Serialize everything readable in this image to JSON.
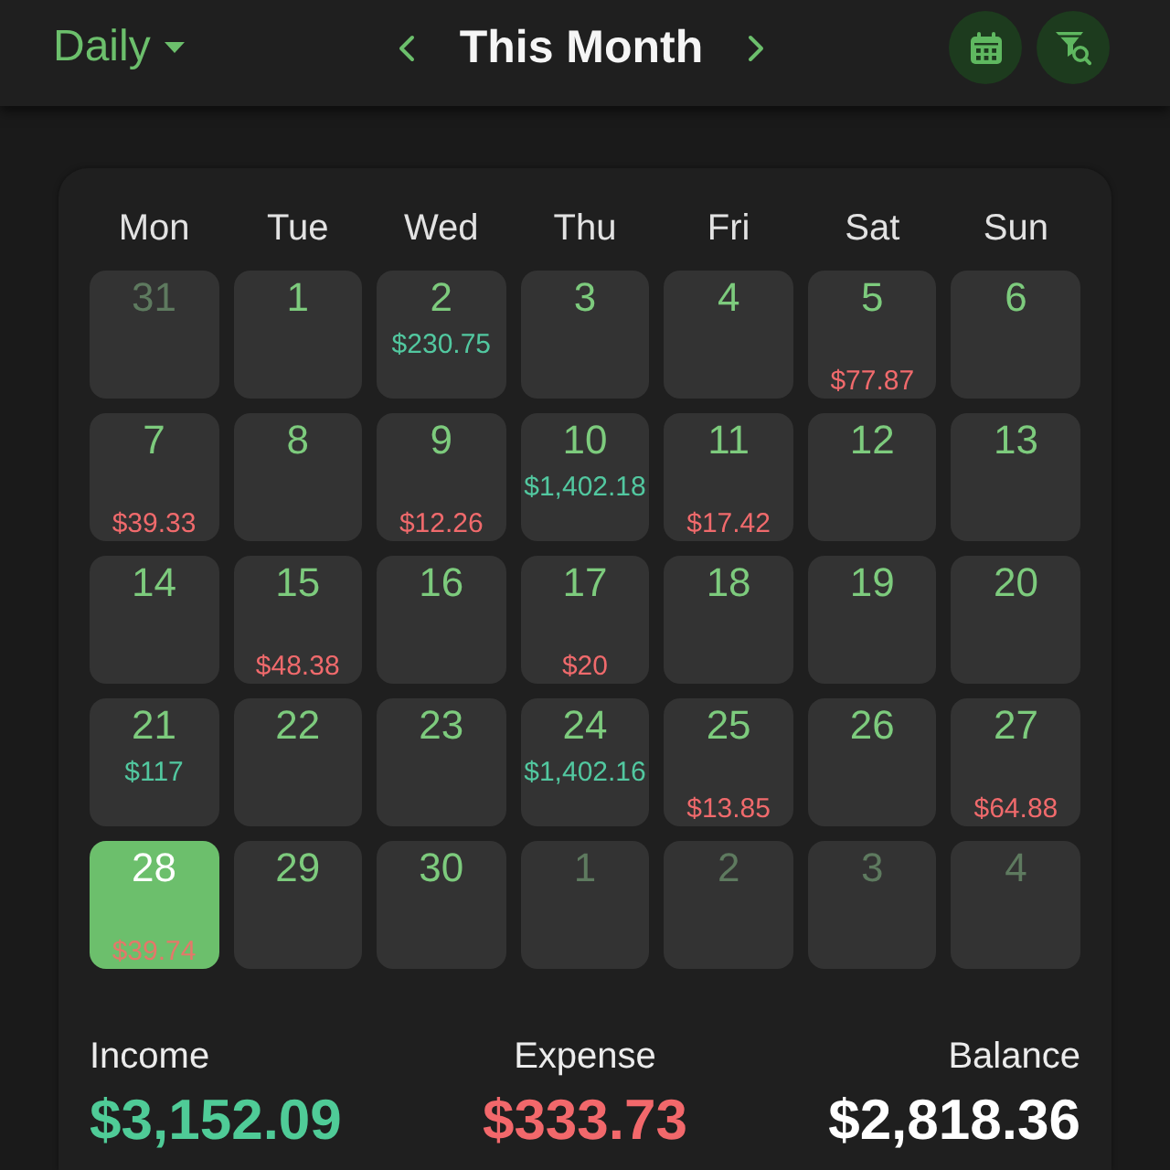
{
  "header": {
    "view_selector": "Daily",
    "title": "This Month"
  },
  "calendar": {
    "weekdays": [
      "Mon",
      "Tue",
      "Wed",
      "Thu",
      "Fri",
      "Sat",
      "Sun"
    ],
    "days": [
      {
        "day": "31",
        "in_month": false,
        "selected": false
      },
      {
        "day": "1",
        "in_month": true,
        "selected": false
      },
      {
        "day": "2",
        "in_month": true,
        "selected": false,
        "income": "$230.75"
      },
      {
        "day": "3",
        "in_month": true,
        "selected": false
      },
      {
        "day": "4",
        "in_month": true,
        "selected": false
      },
      {
        "day": "5",
        "in_month": true,
        "selected": false,
        "expense": "$77.87"
      },
      {
        "day": "6",
        "in_month": true,
        "selected": false
      },
      {
        "day": "7",
        "in_month": true,
        "selected": false,
        "expense": "$39.33"
      },
      {
        "day": "8",
        "in_month": true,
        "selected": false
      },
      {
        "day": "9",
        "in_month": true,
        "selected": false,
        "expense": "$12.26"
      },
      {
        "day": "10",
        "in_month": true,
        "selected": false,
        "income": "$1,402.18"
      },
      {
        "day": "11",
        "in_month": true,
        "selected": false,
        "expense": "$17.42"
      },
      {
        "day": "12",
        "in_month": true,
        "selected": false
      },
      {
        "day": "13",
        "in_month": true,
        "selected": false
      },
      {
        "day": "14",
        "in_month": true,
        "selected": false
      },
      {
        "day": "15",
        "in_month": true,
        "selected": false,
        "expense": "$48.38"
      },
      {
        "day": "16",
        "in_month": true,
        "selected": false
      },
      {
        "day": "17",
        "in_month": true,
        "selected": false,
        "expense": "$20"
      },
      {
        "day": "18",
        "in_month": true,
        "selected": false
      },
      {
        "day": "19",
        "in_month": true,
        "selected": false
      },
      {
        "day": "20",
        "in_month": true,
        "selected": false
      },
      {
        "day": "21",
        "in_month": true,
        "selected": false,
        "income": "$117"
      },
      {
        "day": "22",
        "in_month": true,
        "selected": false
      },
      {
        "day": "23",
        "in_month": true,
        "selected": false
      },
      {
        "day": "24",
        "in_month": true,
        "selected": false,
        "income": "$1,402.16"
      },
      {
        "day": "25",
        "in_month": true,
        "selected": false,
        "expense": "$13.85"
      },
      {
        "day": "26",
        "in_month": true,
        "selected": false
      },
      {
        "day": "27",
        "in_month": true,
        "selected": false,
        "expense": "$64.88"
      },
      {
        "day": "28",
        "in_month": true,
        "selected": true,
        "expense": "$39.74"
      },
      {
        "day": "29",
        "in_month": true,
        "selected": false
      },
      {
        "day": "30",
        "in_month": true,
        "selected": false
      },
      {
        "day": "1",
        "in_month": false,
        "selected": false
      },
      {
        "day": "2",
        "in_month": false,
        "selected": false
      },
      {
        "day": "3",
        "in_month": false,
        "selected": false
      },
      {
        "day": "4",
        "in_month": false,
        "selected": false
      }
    ]
  },
  "summary": [
    {
      "kind": "income",
      "label": "Income",
      "value": "$3,152.09"
    },
    {
      "kind": "expense",
      "label": "Expense",
      "value": "$333.73"
    },
    {
      "kind": "balance",
      "label": "Balance",
      "value": "$2,818.36"
    }
  ]
}
